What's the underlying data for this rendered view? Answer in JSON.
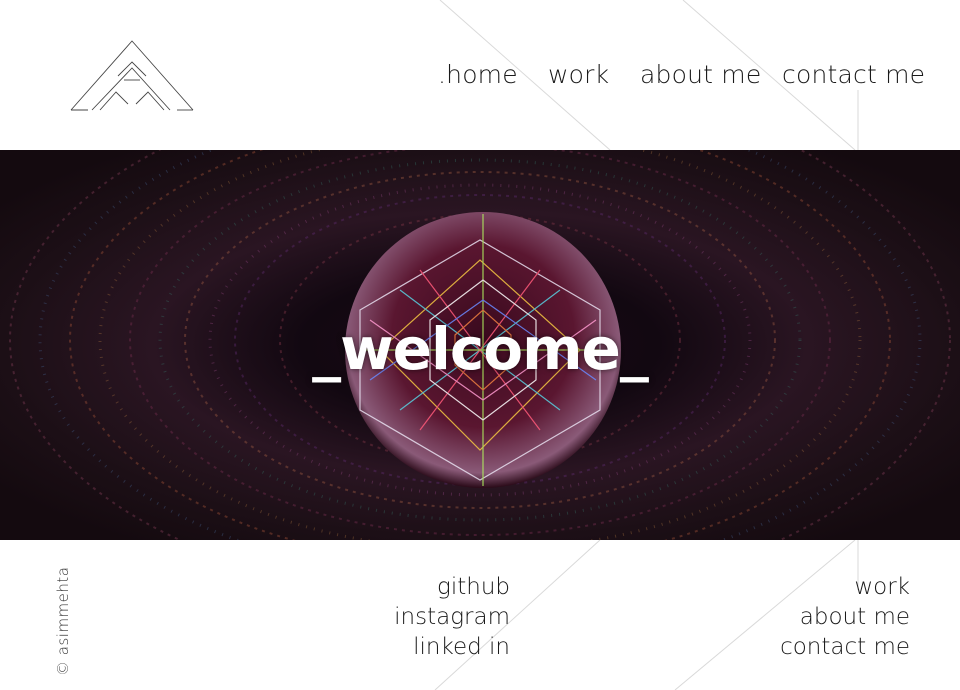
{
  "header": {
    "logo_alt": "A",
    "nav": [
      {
        "label": ".home"
      },
      {
        "label": "work"
      },
      {
        "label": "about me"
      },
      {
        "label": "contact me"
      }
    ]
  },
  "hero": {
    "title": "_welcome_"
  },
  "footer": {
    "copyright": "© asimmehta",
    "social_links": [
      {
        "label": "github"
      },
      {
        "label": "instagram"
      },
      {
        "label": "linked in"
      }
    ],
    "nav_links": [
      {
        "label": "work"
      },
      {
        "label": "about me"
      },
      {
        "label": "contact me"
      }
    ]
  },
  "colors": {
    "background": "#ffffff",
    "text": "#1a1a1a",
    "hero_background": "#0d0709",
    "hero_title": "#ffffff",
    "decor_lines": "#d9d9d9"
  }
}
